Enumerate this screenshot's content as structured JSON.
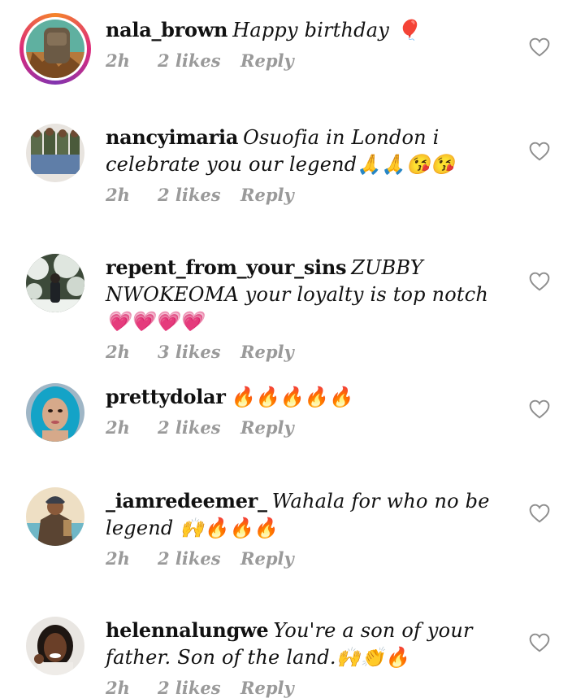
{
  "comments": [
    {
      "username": "nala_brown",
      "text": "Happy birthday 🎈",
      "time": "2h",
      "likes": "2 likes",
      "reply": "Reply",
      "story_ring": true,
      "avatar_icon": "backpack-photo-icon"
    },
    {
      "username": "nancyimaria",
      "text": "Osuofia in London i celebrate you our legend🙏🙏😘😘",
      "time": "2h",
      "likes": "2 likes",
      "reply": "Reply",
      "story_ring": false,
      "avatar_icon": "group-photo-icon"
    },
    {
      "username": "repent_from_your_sins",
      "text": "ZUBBY NWOKEOMA your loyalty is top notch 💗💗💗💗",
      "time": "2h",
      "likes": "3 likes",
      "reply": "Reply",
      "story_ring": false,
      "avatar_icon": "snow-trees-photo-icon"
    },
    {
      "username": "prettydolar",
      "text": "🔥🔥🔥🔥🔥",
      "time": "2h",
      "likes": "2 likes",
      "reply": "Reply",
      "story_ring": false,
      "avatar_icon": "blue-hair-photo-icon"
    },
    {
      "username": "_iamredeemer_",
      "text": "Wahala for who no be legend 🙌🔥🔥🔥",
      "time": "2h",
      "likes": "2 likes",
      "reply": "Reply",
      "story_ring": false,
      "avatar_icon": "man-outdoor-photo-icon"
    },
    {
      "username": "helennalungwe",
      "text": "You're a son of your father. Son of the land.🙌👏🔥",
      "time": "2h",
      "likes": "2 likes",
      "reply": "Reply",
      "story_ring": false,
      "avatar_icon": "woman-smiling-photo-icon"
    }
  ],
  "colors": {
    "meta_text": "#9a9a9a",
    "username": "#111111",
    "heart_outline": "#8e8e8e",
    "story_ring": [
      "#f58529",
      "#dd2a7b",
      "#8134af"
    ]
  }
}
